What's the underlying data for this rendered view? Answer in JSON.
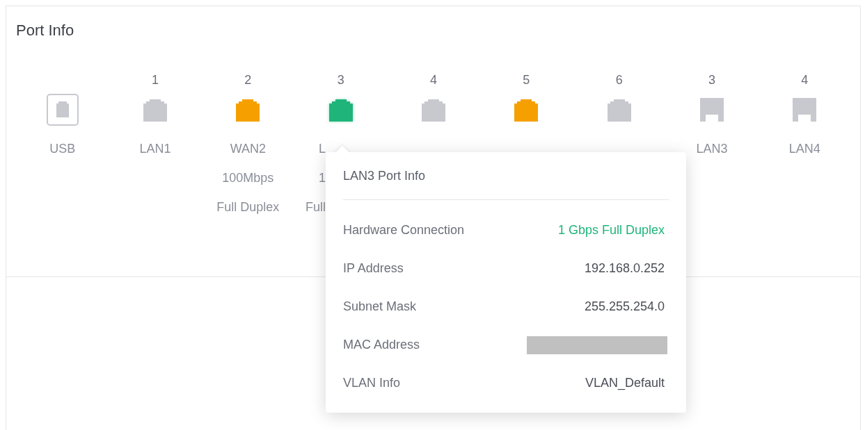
{
  "panel": {
    "title": "Port Info"
  },
  "ports": [
    {
      "kind": "usb",
      "color": "#c8c9ce",
      "selected": false,
      "lines": [
        "USB"
      ]
    },
    {
      "number": "1",
      "kind": "rj45",
      "color": "#c8c9ce",
      "selected": false,
      "lines": [
        "LAN1"
      ]
    },
    {
      "number": "2",
      "kind": "rj45",
      "color": "#f5a000",
      "selected": false,
      "lines": [
        "WAN2",
        "100Mbps",
        "Full Duplex"
      ]
    },
    {
      "number": "3",
      "kind": "rj45",
      "color": "#1fb57a",
      "selected": true,
      "lines": [
        "L",
        "1",
        "Full"
      ]
    },
    {
      "number": "4",
      "kind": "rj45",
      "color": "#c8c9ce",
      "selected": false
    },
    {
      "number": "5",
      "kind": "rj45",
      "color": "#f5a000",
      "selected": false
    },
    {
      "number": "6",
      "kind": "rj45",
      "color": "#c8c9ce",
      "selected": false
    },
    {
      "number": "3",
      "kind": "sfp",
      "color": "#c8c9ce",
      "selected": false,
      "lines": [
        "LAN3"
      ]
    },
    {
      "number": "4",
      "kind": "sfp",
      "color": "#c8c9ce",
      "selected": false,
      "lines": [
        "LAN4"
      ]
    }
  ],
  "popover": {
    "title": "LAN3 Port Info",
    "rows": [
      {
        "kind": "text",
        "label": "Hardware Connection",
        "value": "1 Gbps Full Duplex",
        "color": "#1fb57a"
      },
      {
        "kind": "text",
        "label": "IP Address",
        "value": "192.168.0.252",
        "color": "#4a4d55"
      },
      {
        "kind": "text",
        "label": "Subnet Mask",
        "value": "255.255.254.0",
        "color": "#4a4d55"
      },
      {
        "kind": "redacted",
        "label": "MAC Address"
      },
      {
        "kind": "text",
        "label": "VLAN Info",
        "value": "VLAN_Default",
        "color": "#4a4d55"
      }
    ]
  }
}
